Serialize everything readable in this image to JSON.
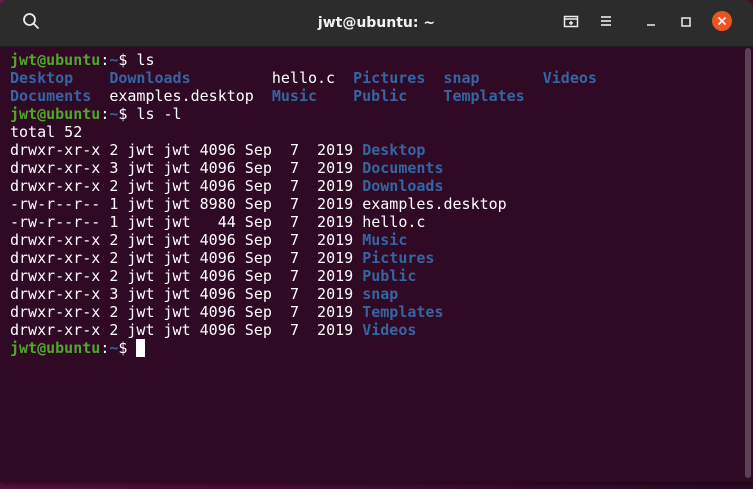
{
  "window": {
    "title": "jwt@ubuntu: ~",
    "close_color": "#e95420"
  },
  "prompt": {
    "user_host": "jwt@ubuntu",
    "colon": ":",
    "path": "~",
    "dollar": "$ "
  },
  "commands": {
    "ls": "ls",
    "ls_l": "ls -l"
  },
  "ls_output": [
    [
      {
        "name": "Desktop",
        "type": "dir"
      },
      {
        "name": "Downloads",
        "type": "dir"
      },
      {
        "name": "hello.c",
        "type": "file"
      },
      {
        "name": "Pictures",
        "type": "dir"
      },
      {
        "name": "snap",
        "type": "dir"
      },
      {
        "name": "Videos",
        "type": "dir"
      }
    ],
    [
      {
        "name": "Documents",
        "type": "dir"
      },
      {
        "name": "examples.desktop",
        "type": "file"
      },
      {
        "name": "Music",
        "type": "dir"
      },
      {
        "name": "Public",
        "type": "dir"
      },
      {
        "name": "Templates",
        "type": "dir"
      }
    ]
  ],
  "total_line": "total 52",
  "listing": [
    {
      "meta": "drwxr-xr-x 2 jwt jwt 4096 Sep  7  2019 ",
      "name": "Desktop",
      "type": "dir"
    },
    {
      "meta": "drwxr-xr-x 3 jwt jwt 4096 Sep  7  2019 ",
      "name": "Documents",
      "type": "dir"
    },
    {
      "meta": "drwxr-xr-x 2 jwt jwt 4096 Sep  7  2019 ",
      "name": "Downloads",
      "type": "dir"
    },
    {
      "meta": "-rw-r--r-- 1 jwt jwt 8980 Sep  7  2019 ",
      "name": "examples.desktop",
      "type": "file"
    },
    {
      "meta": "-rw-r--r-- 1 jwt jwt   44 Sep  7  2019 ",
      "name": "hello.c",
      "type": "file"
    },
    {
      "meta": "drwxr-xr-x 2 jwt jwt 4096 Sep  7  2019 ",
      "name": "Music",
      "type": "dir"
    },
    {
      "meta": "drwxr-xr-x 2 jwt jwt 4096 Sep  7  2019 ",
      "name": "Pictures",
      "type": "dir"
    },
    {
      "meta": "drwxr-xr-x 2 jwt jwt 4096 Sep  7  2019 ",
      "name": "Public",
      "type": "dir"
    },
    {
      "meta": "drwxr-xr-x 3 jwt jwt 4096 Sep  7  2019 ",
      "name": "snap",
      "type": "dir"
    },
    {
      "meta": "drwxr-xr-x 2 jwt jwt 4096 Sep  7  2019 ",
      "name": "Templates",
      "type": "dir"
    },
    {
      "meta": "drwxr-xr-x 2 jwt jwt 4096 Sep  7  2019 ",
      "name": "Videos",
      "type": "dir"
    }
  ],
  "icons": {
    "search": "search-icon",
    "new_tab": "new-tab-icon",
    "menu": "hamburger-menu-icon",
    "minimize": "minimize-icon",
    "maximize": "maximize-icon",
    "close": "close-icon"
  }
}
